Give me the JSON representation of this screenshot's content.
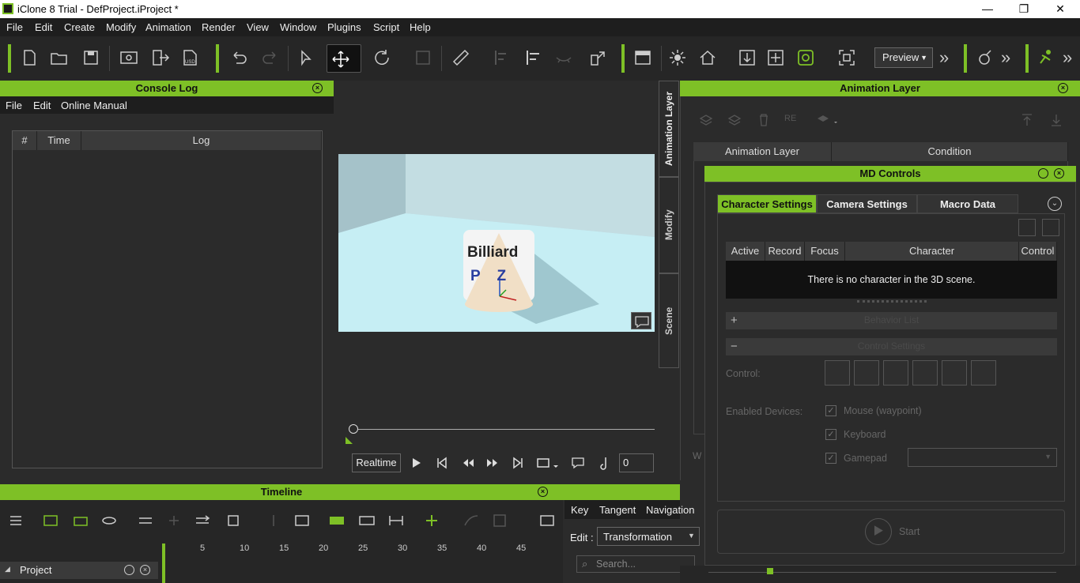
{
  "window": {
    "title": "iClone 8 Trial - DefProject.iProject *",
    "minimize": "—",
    "restore": "❐",
    "close": "✕"
  },
  "menu": [
    "File",
    "Edit",
    "Create",
    "Modify",
    "Animation",
    "Render",
    "View",
    "Window",
    "Plugins",
    "Script",
    "Help"
  ],
  "toolbar": {
    "preview_label": "Preview",
    "more": "»"
  },
  "console": {
    "title": "Console Log",
    "menu": [
      "File",
      "Edit",
      "Online Manual"
    ],
    "columns": [
      "#",
      "Time",
      "Log"
    ]
  },
  "viewport": {
    "billboard_text_1": "Billiard",
    "billboard_text_2": "P    Z"
  },
  "playback": {
    "mode": "Realtime",
    "frame": "0"
  },
  "side_tabs": [
    "Animation Layer",
    "Modify",
    "Scene"
  ],
  "anim_layer": {
    "title": "Animation Layer",
    "columns": [
      "Animation Layer",
      "Condition"
    ],
    "re_label": "RE"
  },
  "md_controls": {
    "title": "MD Controls",
    "tabs": [
      "Character Settings",
      "Camera Settings",
      "Macro Data"
    ],
    "columns": [
      "Active",
      "Record",
      "Focus",
      "Character",
      "Control"
    ],
    "empty_message": "There is no character in the 3D scene.",
    "behavior_list": "Behavior List",
    "control_settings": "Control Settings",
    "plus": "+",
    "minus": "−",
    "control_label": "Control:",
    "enabled_devices_label": "Enabled Devices:",
    "devices": [
      "Mouse (waypoint)",
      "Keyboard",
      "Gamepad"
    ],
    "start": "Start",
    "side_letter": "W"
  },
  "timeline": {
    "title": "Timeline",
    "ticks": [
      "5",
      "10",
      "15",
      "20",
      "25",
      "30",
      "35",
      "40",
      "45"
    ],
    "project_label": "Project"
  },
  "curve_panel": {
    "tabs": [
      "Key",
      "Tangent",
      "Navigation"
    ],
    "edit_label": "Edit :",
    "edit_value": "Transformation",
    "search_placeholder": "Search..."
  },
  "colors": {
    "accent": "#7ec026",
    "panel": "#2b2b2b",
    "header": "#3a3a3a"
  }
}
